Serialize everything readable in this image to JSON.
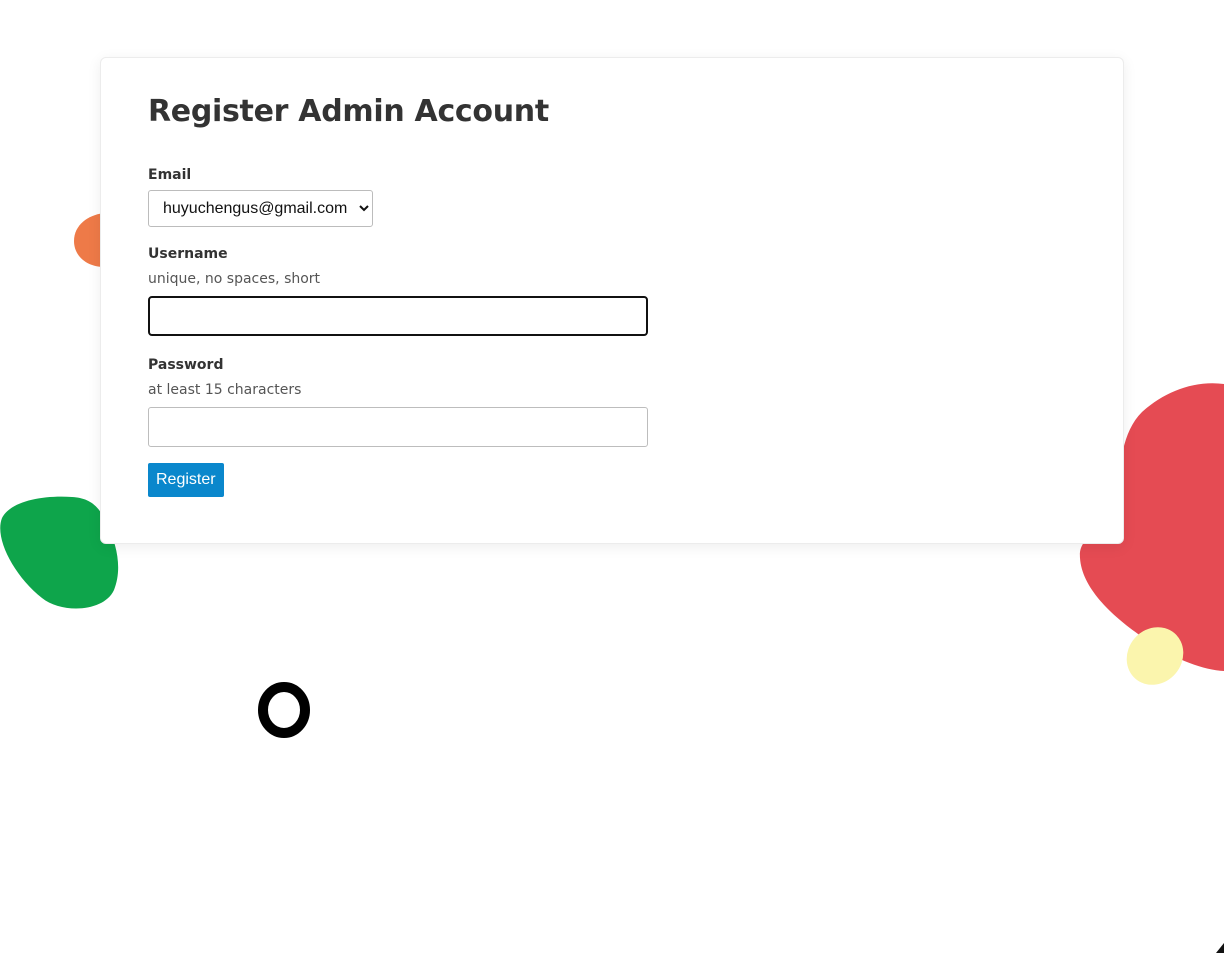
{
  "form": {
    "title": "Register Admin Account",
    "email": {
      "label": "Email",
      "selected_value": "huyuchengus@gmail.com"
    },
    "username": {
      "label": "Username",
      "hint": "unique, no spaces, short",
      "value": ""
    },
    "password": {
      "label": "Password",
      "hint": "at least 15 characters",
      "value": ""
    },
    "submit_label": "Register"
  },
  "colors": {
    "accent": "#0a87cc",
    "blob_orange": "#ee7a48",
    "blob_green": "#0ea54b",
    "blob_red": "#e54b53",
    "blob_yellow": "#fbf5ad",
    "ring": "#000000"
  }
}
